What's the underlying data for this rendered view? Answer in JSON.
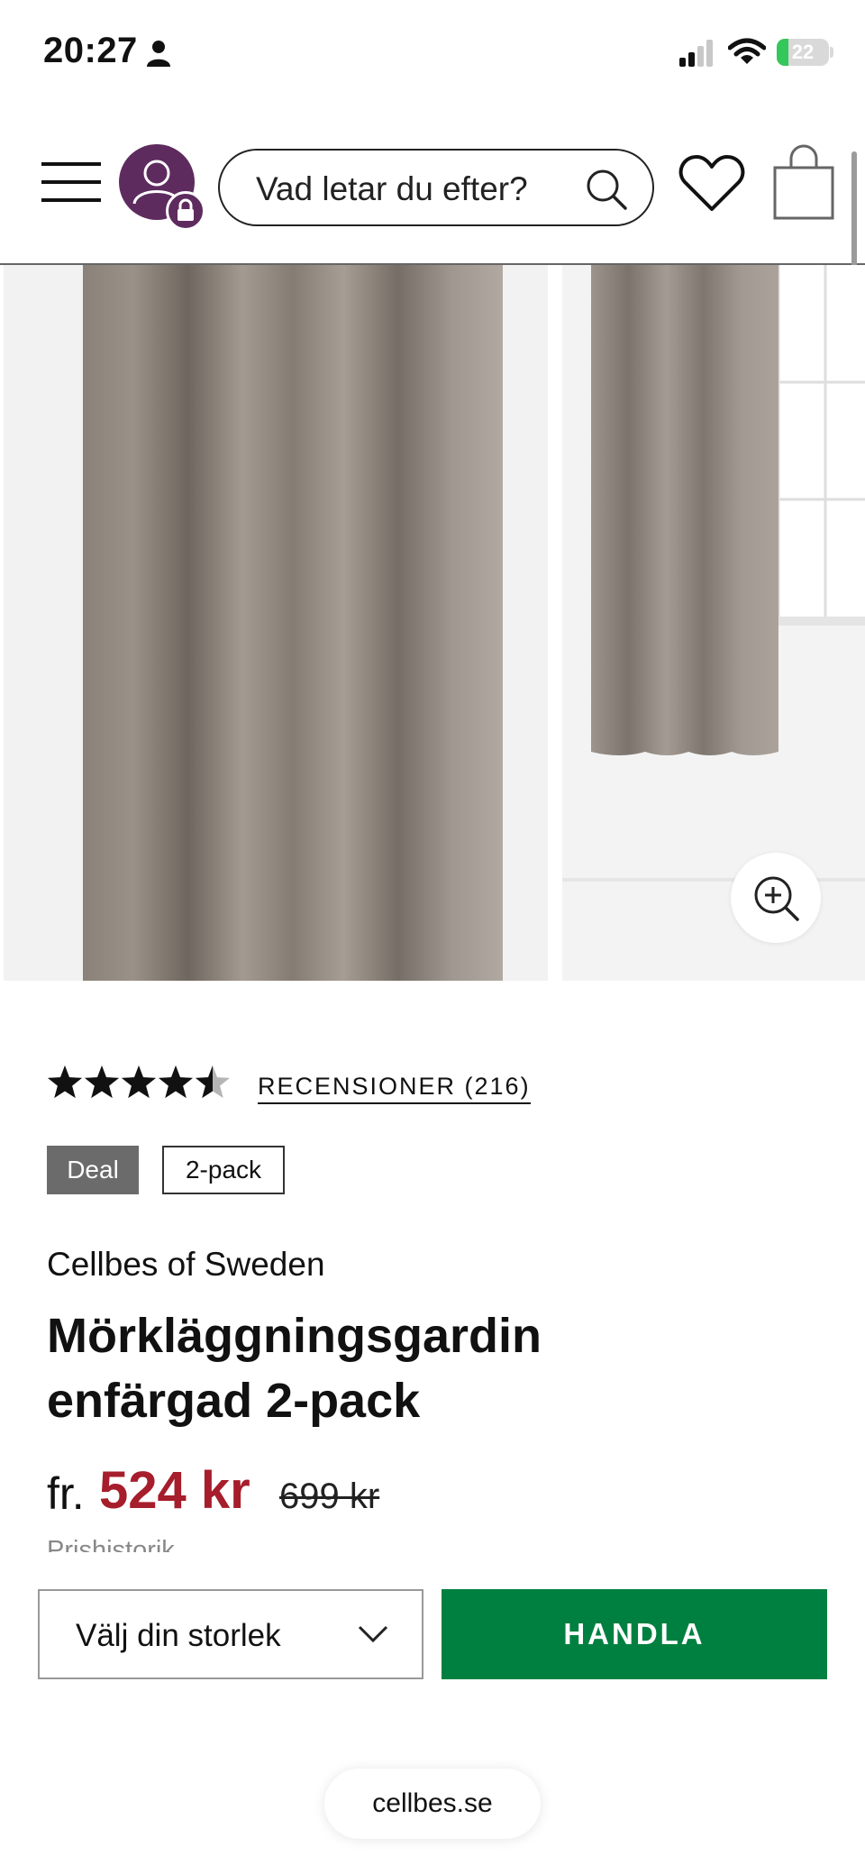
{
  "status_bar": {
    "time": "20:27",
    "battery_level": "22"
  },
  "header": {
    "search_placeholder": "Vad letar du efter?",
    "icons": [
      "menu-icon",
      "account-icon",
      "lock-icon",
      "search-icon",
      "heart-icon",
      "bag-icon"
    ]
  },
  "gallery": {
    "images": [
      "curtain-closeup-image",
      "curtain-room-image"
    ],
    "zoom_icon": "zoom-in-icon"
  },
  "product": {
    "rating": 4.5,
    "rating_max": 5,
    "reviews_label": "RECENSIONER (216)",
    "badges": [
      "Deal",
      "2-pack"
    ],
    "brand": "Cellbes of Sweden",
    "title_line1": "Mörkläggningsgardin",
    "title_line2": "enfärgad 2-pack",
    "price_prefix": "fr.",
    "price": "524 kr",
    "price_old": "699 kr",
    "price_history_label": "Prishistorik"
  },
  "actions": {
    "size_select_label": "Välj din storlek",
    "buy_label": "HANDLA"
  },
  "browser": {
    "url": "cellbes.se"
  },
  "colors": {
    "brand_purple": "#5e2b5f",
    "price_red": "#a61d2b",
    "buy_green": "#008040",
    "deal_gray": "#6b6b6b"
  }
}
